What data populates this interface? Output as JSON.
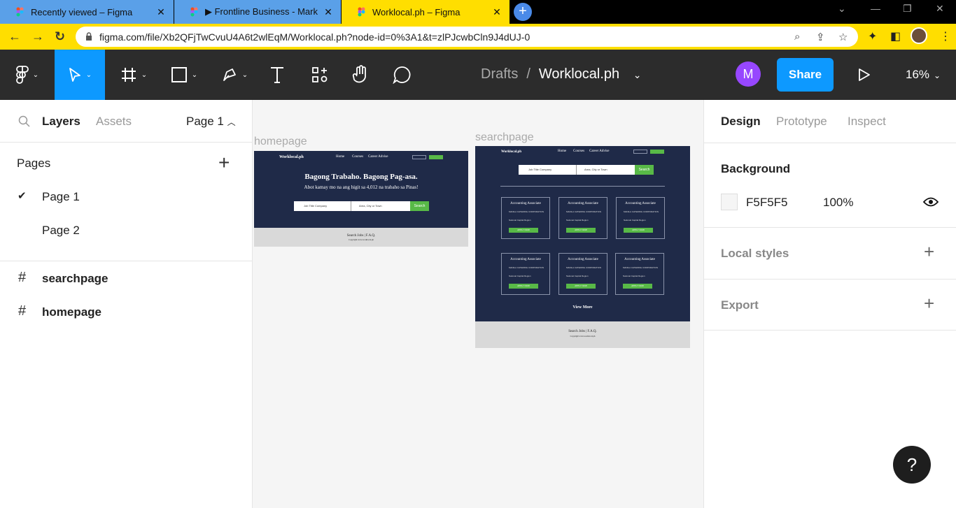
{
  "browser": {
    "tabs": [
      {
        "title": "Recently viewed – Figma",
        "close": "✕"
      },
      {
        "title": "▶ Frontline Business - Mark Lore",
        "close": "✕"
      },
      {
        "title": "Worklocal.ph – Figma",
        "close": "✕"
      }
    ],
    "new_tab": "+",
    "url": "figma.com/file/Xb2QFjTwCvuU4A6t2wlEqM/Worklocal.ph?node-id=0%3A1&t=zlPJcwbCln9J4dUJ-0"
  },
  "toolbar": {
    "breadcrumb_folder": "Drafts",
    "breadcrumb_sep": "/",
    "file_name": "Worklocal.ph",
    "avatar_initial": "M",
    "share_label": "Share",
    "zoom": "16%"
  },
  "left_panel": {
    "tabs": [
      "Layers",
      "Assets"
    ],
    "page_selector": "Page 1",
    "pages_title": "Pages",
    "pages": [
      {
        "name": "Page 1",
        "selected": true
      },
      {
        "name": "Page 2",
        "selected": false
      }
    ],
    "frames": [
      "searchpage",
      "homepage"
    ]
  },
  "canvas": {
    "homepage": {
      "label": "homepage",
      "logo": "Worklocal.ph",
      "nav": [
        "Home",
        "Courses",
        "Career Advise"
      ],
      "headline": "Bagong Trabaho. Bagong Pag-asa.",
      "subhead": "Abot kamay mo na ang higit sa 4,012 na trabaho sa Pinas!",
      "job_placeholder": "Job Title Company",
      "loc_placeholder": "Area, City or Town",
      "search_btn": "Search",
      "footer_links": "Search Jobs | F.A.Q.",
      "footer_copy": "Copyright www.worklocal.ph"
    },
    "searchpage": {
      "label": "searchpage",
      "logo": "Worklocal.ph",
      "nav": [
        "Home",
        "Courses",
        "Career Advise"
      ],
      "job_placeholder": "Job Title Company",
      "loc_placeholder": "Area, City or Town",
      "search_btn": "Search",
      "cards": [
        {
          "title": "Accounting Associate",
          "company": "MANILA CATERING CORPORATION",
          "location": "National Capital Region",
          "button": "APPLY NOW"
        },
        {
          "title": "Accounting Associate",
          "company": "MANILA CATERING CORPORATION",
          "location": "National Capital Region",
          "button": "APPLY NOW"
        },
        {
          "title": "Accounting Associate",
          "company": "MANILA CATERING CORPORATION",
          "location": "National Capital Region",
          "button": "APPLY NOW"
        },
        {
          "title": "Accounting Associate",
          "company": "MANILA CATERING CORPORATION",
          "location": "National Capital Region",
          "button": "APPLY NOW"
        },
        {
          "title": "Accounting Associate",
          "company": "MANILA CATERING CORPORATION",
          "location": "National Capital Region",
          "button": "APPLY NOW"
        },
        {
          "title": "Accounting Associate",
          "company": "MANILA CATERING CORPORATION",
          "location": "National Capital Region",
          "button": "APPLY NOW"
        }
      ],
      "view_more": "View More",
      "footer_links": "Search Jobs | F.A.Q.",
      "footer_copy": "Copyright www.worklocal.ph"
    }
  },
  "right_panel": {
    "tabs": [
      "Design",
      "Prototype",
      "Inspect"
    ],
    "background_title": "Background",
    "bg_hex": "F5F5F5",
    "bg_opacity": "100%",
    "local_styles": "Local styles",
    "export": "Export",
    "help": "?"
  },
  "colors": {
    "accent": "#0d99ff",
    "avatar": "#9747ff",
    "navy": "#1f2a48",
    "green": "#58b947"
  }
}
